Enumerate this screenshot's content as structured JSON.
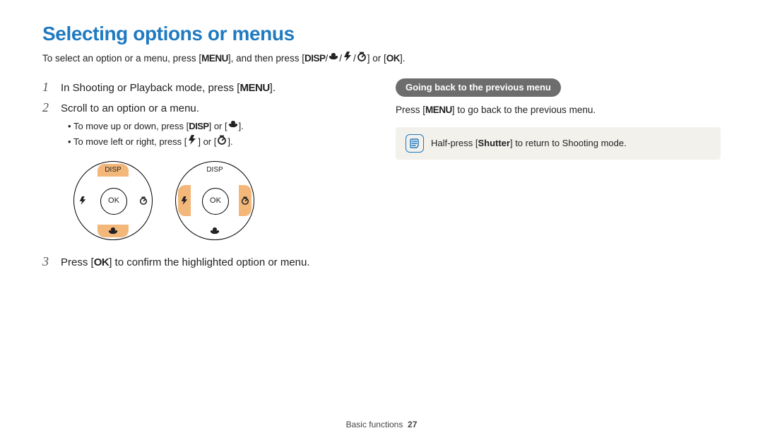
{
  "title": "Selecting options or menus",
  "intro_parts": {
    "a": "To select an option or a menu, press [",
    "menu": "MENU",
    "b": "], and then press [",
    "disp": "DISP",
    "c": "/",
    "d": "] or [",
    "ok": "OK",
    "e": "]."
  },
  "steps": {
    "s1": {
      "num": "1",
      "a": "In Shooting or Playback mode, press [",
      "menu": "MENU",
      "b": "]."
    },
    "s2": {
      "num": "2",
      "text": "Scroll to an option or a menu.",
      "sub1": {
        "a": "To move up or down, press [",
        "disp": "DISP",
        "b": "] or [",
        "c": "]."
      },
      "sub2": {
        "a": "To move left or right, press [",
        "b": "] or [",
        "c": "]."
      }
    },
    "s3": {
      "num": "3",
      "a": "Press [",
      "ok": "OK",
      "b": "] to confirm the highlighted option or menu."
    }
  },
  "dials": {
    "disp": "DISP",
    "ok": "OK"
  },
  "right": {
    "pill": "Going back to the previous menu",
    "line": {
      "a": "Press [",
      "menu": "MENU",
      "b": "] to go back to the previous menu."
    },
    "note": {
      "a": "Half-press [",
      "shutter": "Shutter",
      "b": "] to return to Shooting mode."
    }
  },
  "footer": {
    "section": "Basic functions",
    "page": "27"
  }
}
